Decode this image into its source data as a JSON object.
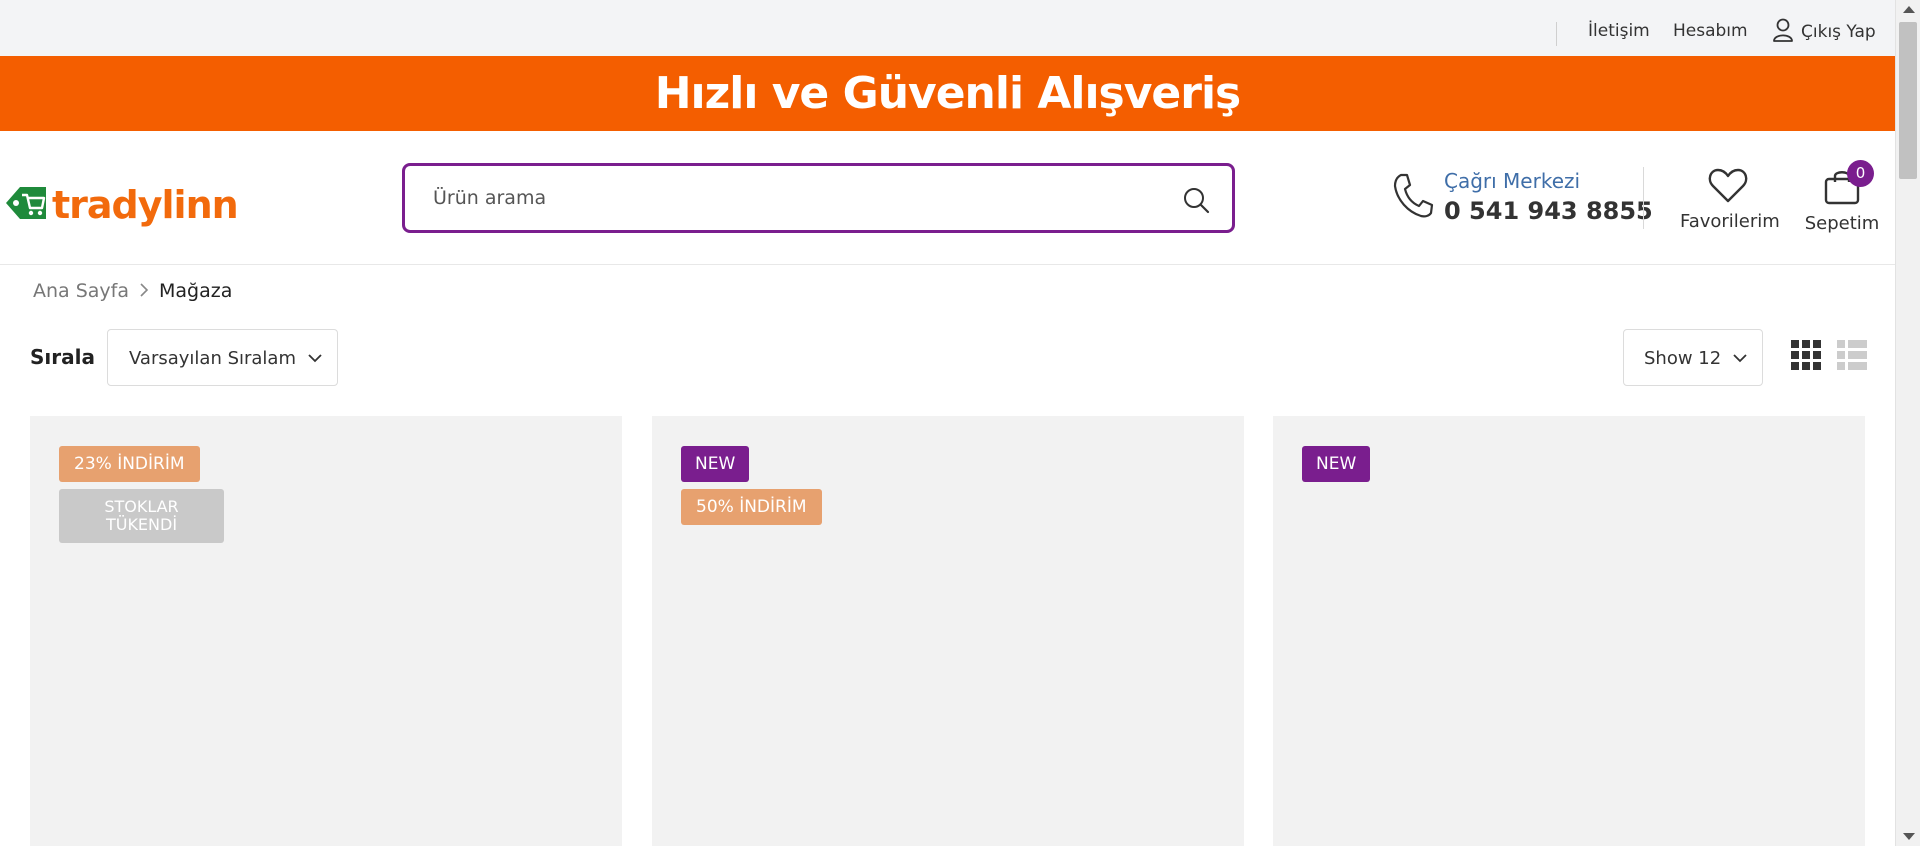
{
  "topbar": {
    "contact_label": "İletişim",
    "account_label": "Hesabım",
    "logout_label": "Çıkış Yap",
    "logout_icon": "user-icon"
  },
  "promo": {
    "text": "Hızlı ve Güvenli Alışveriş",
    "background": "#f45e00"
  },
  "header": {
    "logo_text": "tradylinn",
    "logo_icon": "shopping-cart-tag-icon",
    "search": {
      "placeholder": "Ürün arama",
      "value": "",
      "icon": "search-icon"
    },
    "call_center": {
      "label": "Çağrı Merkezi",
      "phone": "0 541 943 8855",
      "icon": "phone-icon"
    },
    "favorites": {
      "label": "Favorilerim",
      "icon": "heart-icon"
    },
    "cart": {
      "label": "Sepetim",
      "count": "0",
      "icon": "shopping-bag-icon"
    }
  },
  "breadcrumb": {
    "home": "Ana Sayfa",
    "separator_icon": "chevron-right-icon",
    "current": "Mağaza"
  },
  "toolbar": {
    "sort_label": "Sırala",
    "sort_selected": "Varsayılan Sıralama",
    "show_selected": "Show 12",
    "view_modes": [
      "grid-view-icon",
      "list-view-icon"
    ],
    "active_view": "grid"
  },
  "products": [
    {
      "badges": [
        {
          "type": "discount",
          "text": "23% İNDİRİM"
        },
        {
          "type": "stock",
          "text_line1": "STOKLAR",
          "text_line2": "TÜKENDİ"
        }
      ]
    },
    {
      "badges": [
        {
          "type": "new",
          "text": "NEW"
        },
        {
          "type": "discount",
          "text": "50% İNDİRİM"
        }
      ]
    },
    {
      "badges": [
        {
          "type": "new",
          "text": "NEW"
        }
      ]
    }
  ],
  "colors": {
    "brand_orange": "#f45e00",
    "brand_purple": "#7a1e8e",
    "discount_badge": "#e7a16f",
    "stock_badge": "#c9c9c9",
    "call_center_blue": "#3f6ea8"
  }
}
